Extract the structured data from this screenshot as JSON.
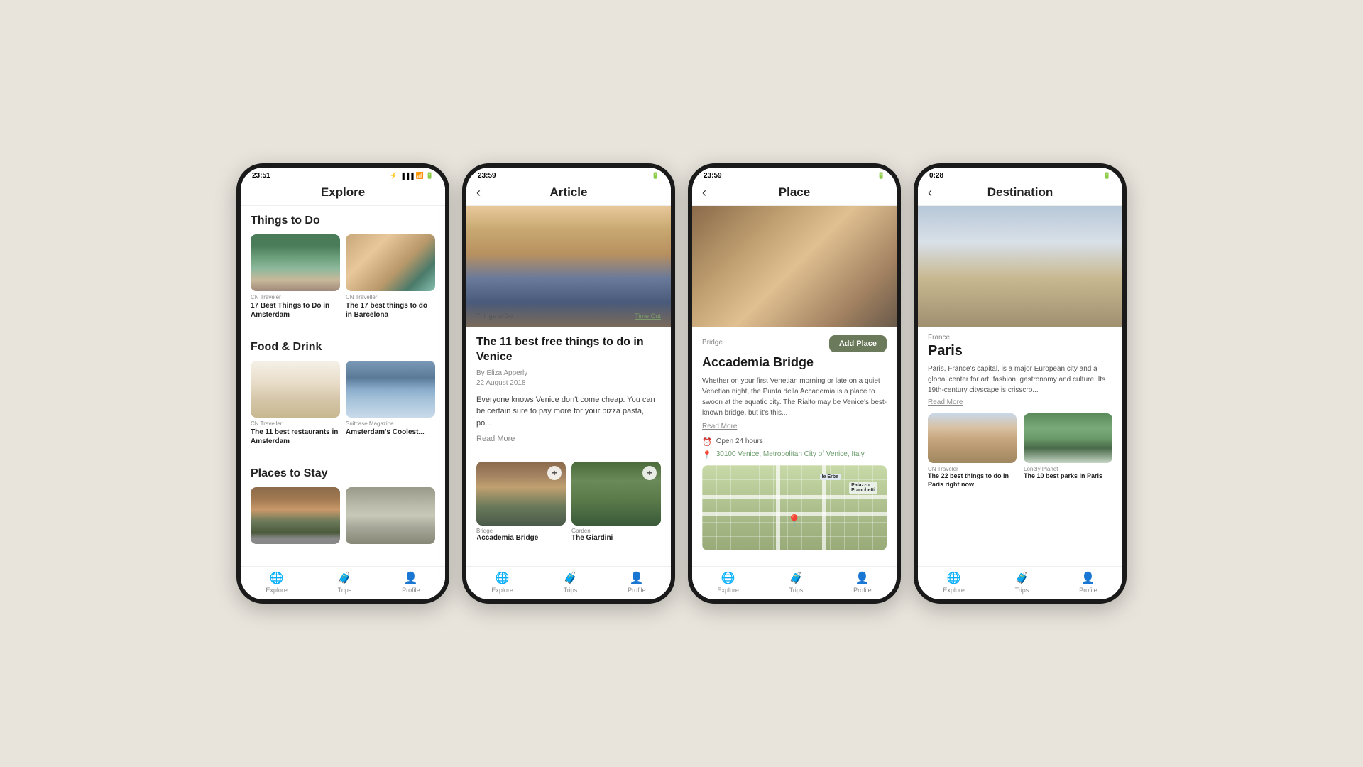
{
  "background": "#e8e4dc",
  "phones": [
    {
      "id": "explore",
      "statusBar": {
        "time": "23:51",
        "icons": "🔔 ⏰ 📶 📶 🔋"
      },
      "header": {
        "title": "Explore",
        "hasBack": false
      },
      "sections": [
        {
          "title": "Things to Do",
          "cards": [
            {
              "source": "CN Traveler",
              "title": "17 Best Things to Do in Amsterdam",
              "img": "amsterdam-canal"
            },
            {
              "source": "CN Traveller",
              "title": "The 17 best things to do in Barcelona",
              "img": "barcelona"
            }
          ]
        },
        {
          "title": "Food & Drink",
          "cards": [
            {
              "source": "CN Traveller",
              "title": "The 11 best restaurants in Amsterdam",
              "img": "restaurant"
            },
            {
              "source": "Suitcase Magazine",
              "title": "Amsterdam's Coolest...",
              "img": "amsterdam-cool"
            }
          ]
        },
        {
          "title": "Places to Stay",
          "cards": [
            {
              "source": "",
              "title": "",
              "img": "hotel"
            },
            {
              "source": "",
              "title": "",
              "img": "hotel2"
            }
          ]
        }
      ],
      "nav": [
        "Explore",
        "Trips",
        "Profile"
      ]
    },
    {
      "id": "article",
      "statusBar": {
        "time": "23:59",
        "icons": "🔔 ⏰ 📶 📶 🔋"
      },
      "header": {
        "title": "Article",
        "hasBack": true
      },
      "article": {
        "heroImg": "venice-square",
        "tag": "Things to Do",
        "source": "Time Out",
        "title": "The 11 best free things to do in Venice",
        "author": "By Eliza Apperly",
        "date": "22 August 2018",
        "excerpt": "Everyone knows Venice don't come cheap. You can be certain sure to pay more for your pizza pasta, po...",
        "readMore": "Read More",
        "places": [
          {
            "type": "Bridge",
            "name": "Accademia Bridge",
            "img": "bridge"
          },
          {
            "type": "Garden",
            "name": "The Giardini",
            "img": "garden"
          }
        ]
      },
      "nav": [
        "Explore",
        "Trips",
        "Profile"
      ]
    },
    {
      "id": "place",
      "statusBar": {
        "time": "23:59",
        "icons": "🔔 ⏰ 📶 📶 🔋"
      },
      "header": {
        "title": "Place",
        "hasBack": true
      },
      "place": {
        "heroImg": "accademia-bridge",
        "type": "Bridge",
        "addBtn": "Add Place",
        "name": "Accademia Bridge",
        "desc": "Whether on your first Venetian morning or late on a quiet Venetian night, the Punta della Accademia is a place to swoon at the aquatic city. The Rialto may be Venice's best-known bridge, but it's this...",
        "readMore": "Read More",
        "hours": "Open 24 hours",
        "address": "30100 Venice, Metropolitan City of Venice, Italy",
        "map": true
      },
      "nav": [
        "Explore",
        "Trips",
        "Profile"
      ]
    },
    {
      "id": "destination",
      "statusBar": {
        "time": "0:28",
        "icons": "🔔 ⏰ 📶 📶 🔋"
      },
      "header": {
        "title": "Destination",
        "hasBack": true
      },
      "destination": {
        "heroImg": "paris-eiffel",
        "country": "France",
        "name": "Paris",
        "desc": "Paris, France's capital, is a major European city and a global center for art, fashion, gastronomy and culture. Its 19th-century cityscape is crisscro...",
        "readMore": "Read More",
        "articles": [
          {
            "source": "CN Traveler",
            "title": "The 22 best things to do in Paris right now",
            "img": "paris-city"
          },
          {
            "source": "Lonely Planet",
            "title": "The 10 best parks in Paris",
            "img": "paris-park"
          }
        ]
      },
      "nav": [
        "Explore",
        "Trips",
        "Profile"
      ]
    }
  ]
}
